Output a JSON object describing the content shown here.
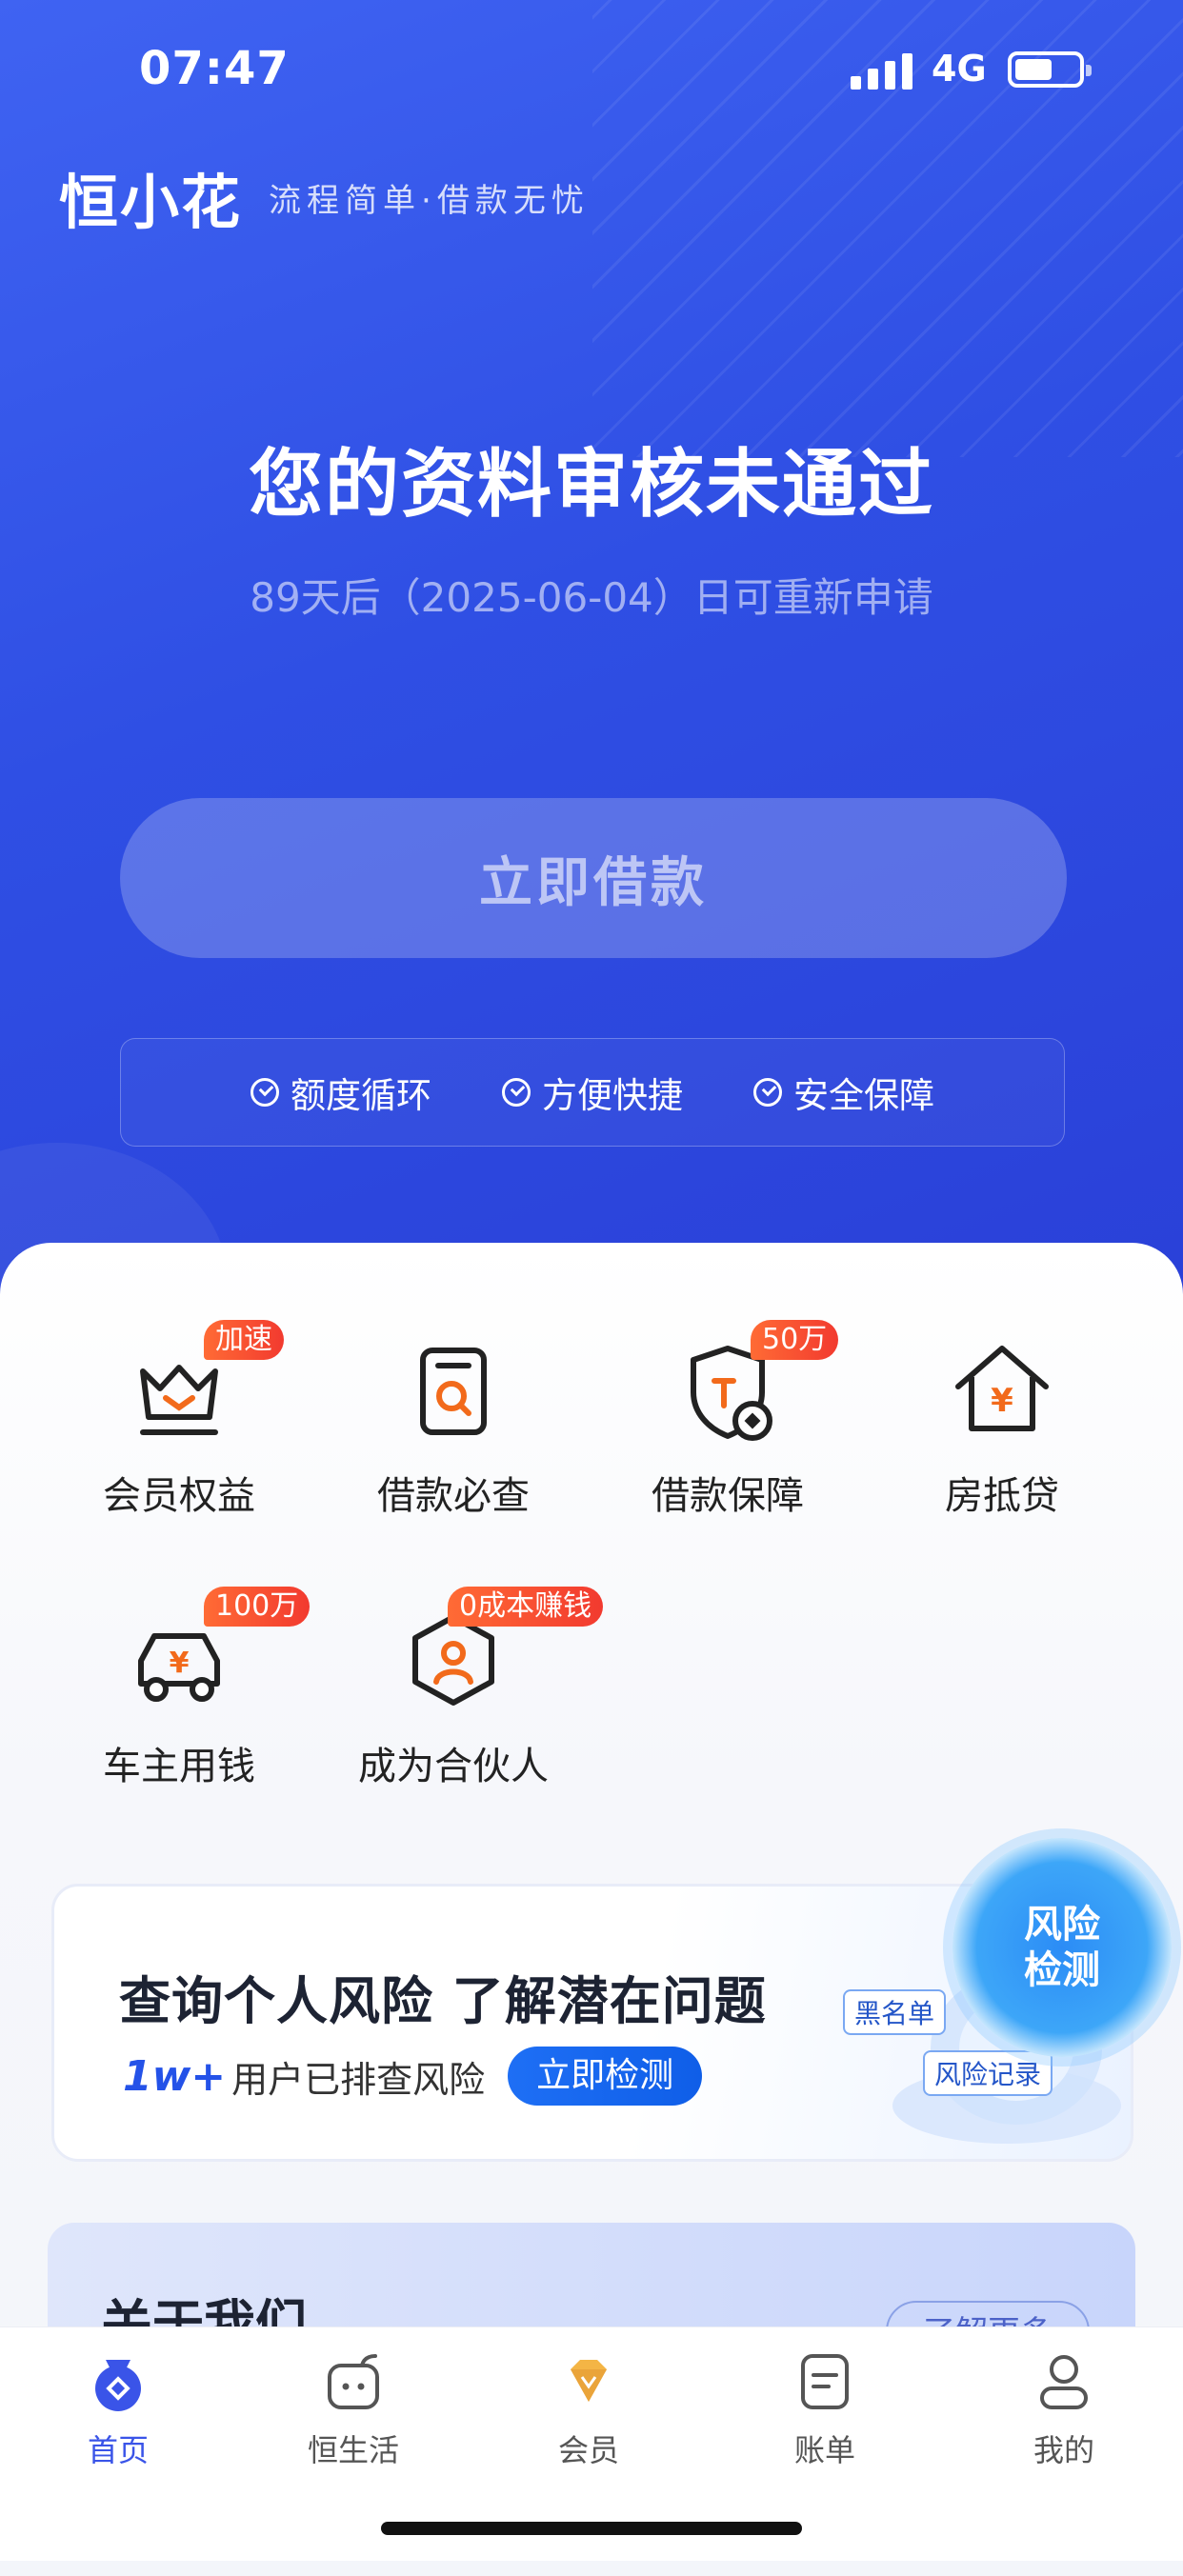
{
  "status": {
    "time": "07:47",
    "network": "4G"
  },
  "brand": {
    "logo": "恒小花",
    "slogan": "流程简单·借款无忧"
  },
  "hero": {
    "title": "您的资料审核未通过",
    "subtitle": "89天后（2025-06-04）日可重新申请",
    "borrow_button": "立即借款",
    "features": [
      "额度循环",
      "方便快捷",
      "安全保障"
    ]
  },
  "services": [
    {
      "label": "会员权益",
      "badge": "加速",
      "icon": "crown-icon"
    },
    {
      "label": "借款必查",
      "badge": "",
      "icon": "document-search-icon"
    },
    {
      "label": "借款保障",
      "badge": "50万",
      "icon": "shield-icon"
    },
    {
      "label": "房抵贷",
      "badge": "",
      "icon": "house-yen-icon"
    },
    {
      "label": "车主用钱",
      "badge": "100万",
      "icon": "car-yen-icon"
    },
    {
      "label": "成为合伙人",
      "badge": "0成本赚钱",
      "icon": "partner-icon"
    }
  ],
  "risk_card": {
    "title": "查询个人风险 了解潜在问题",
    "count": "1w+",
    "count_suffix": "用户已排查风险",
    "button": "立即检测",
    "bubble_line1": "风险",
    "bubble_line2": "检测",
    "tag_blacklist": "黑名单",
    "tag_record": "风险记录"
  },
  "about": {
    "title": "关于我们",
    "more": "了解更多"
  },
  "tabbar": [
    {
      "label": "首页",
      "icon": "home-icon",
      "active": true
    },
    {
      "label": "恒生活",
      "icon": "life-icon",
      "active": false
    },
    {
      "label": "会员",
      "icon": "diamond-icon",
      "active": false
    },
    {
      "label": "账单",
      "icon": "bill-icon",
      "active": false
    },
    {
      "label": "我的",
      "icon": "profile-icon",
      "active": false
    }
  ],
  "colors": {
    "primary": "#3a54e8",
    "badge": "#f23a2f",
    "icon_accent": "#f26a1b"
  }
}
